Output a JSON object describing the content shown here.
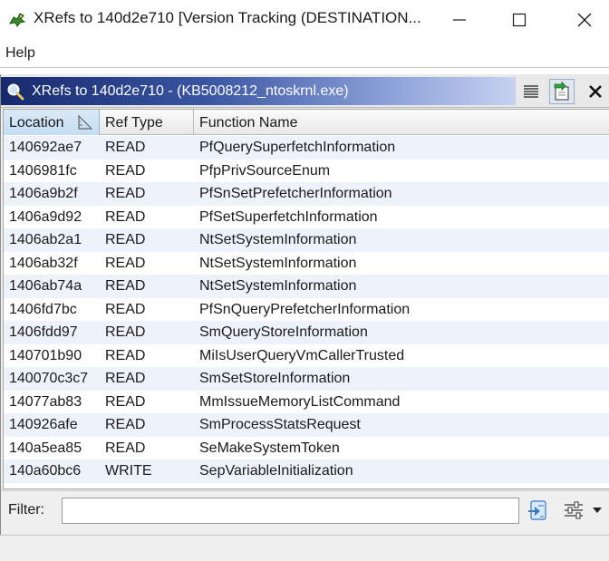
{
  "window": {
    "title": "XRefs to 140d2e710 [Version Tracking (DESTINATION...",
    "icons": {
      "app": "dragon-icon",
      "minimize": "minimize-icon",
      "maximize": "maximize-icon",
      "close": "close-icon"
    }
  },
  "menubar": {
    "items": [
      {
        "label": "Help"
      }
    ]
  },
  "panel": {
    "title": "XRefs to 140d2e710 - (KB5008212_ntoskrnl.exe)",
    "icons": {
      "tab": "magnifier-icon",
      "list": "list-icon",
      "navigate": "navigate-icon",
      "close": "close-x-icon"
    }
  },
  "table": {
    "columns": [
      "Location",
      "Ref Type",
      "Function Name"
    ],
    "sort_icon": "sort-ascending-icon",
    "rows": [
      {
        "location": "140692ae7",
        "ref_type": "READ",
        "function": "PfQuerySuperfetchInformation"
      },
      {
        "location": "1406981fc",
        "ref_type": "READ",
        "function": "PfpPrivSourceEnum"
      },
      {
        "location": "1406a9b2f",
        "ref_type": "READ",
        "function": "PfSnSetPrefetcherInformation"
      },
      {
        "location": "1406a9d92",
        "ref_type": "READ",
        "function": "PfSetSuperfetchInformation"
      },
      {
        "location": "1406ab2a1",
        "ref_type": "READ",
        "function": "NtSetSystemInformation"
      },
      {
        "location": "1406ab32f",
        "ref_type": "READ",
        "function": "NtSetSystemInformation"
      },
      {
        "location": "1406ab74a",
        "ref_type": "READ",
        "function": "NtSetSystemInformation"
      },
      {
        "location": "1406fd7bc",
        "ref_type": "READ",
        "function": "PfSnQueryPrefetcherInformation"
      },
      {
        "location": "1406fdd97",
        "ref_type": "READ",
        "function": "SmQueryStoreInformation"
      },
      {
        "location": "140701b90",
        "ref_type": "READ",
        "function": "MiIsUserQueryVmCallerTrusted"
      },
      {
        "location": "140070c3c7",
        "ref_type": "READ",
        "function": "SmSetStoreInformation"
      },
      {
        "location": "14077ab83",
        "ref_type": "READ",
        "function": "MmIssueMemoryListCommand"
      },
      {
        "location": "140926afe",
        "ref_type": "READ",
        "function": "SmProcessStatsRequest"
      },
      {
        "location": "140a5ea85",
        "ref_type": "READ",
        "function": "SeMakeSystemToken"
      },
      {
        "location": "140a60bc6",
        "ref_type": "WRITE",
        "function": "SepVariableInitialization"
      }
    ]
  },
  "filter": {
    "label": "Filter:",
    "value": "",
    "placeholder": "",
    "icons": {
      "apply": "filter-apply-icon",
      "options": "filter-options-icon"
    }
  },
  "colors": {
    "panel_tab_start": "#17296d",
    "panel_tab_end": "#c6d2f0",
    "row_alt": "#eef3fb",
    "selected_header": "#c4dcf3"
  }
}
